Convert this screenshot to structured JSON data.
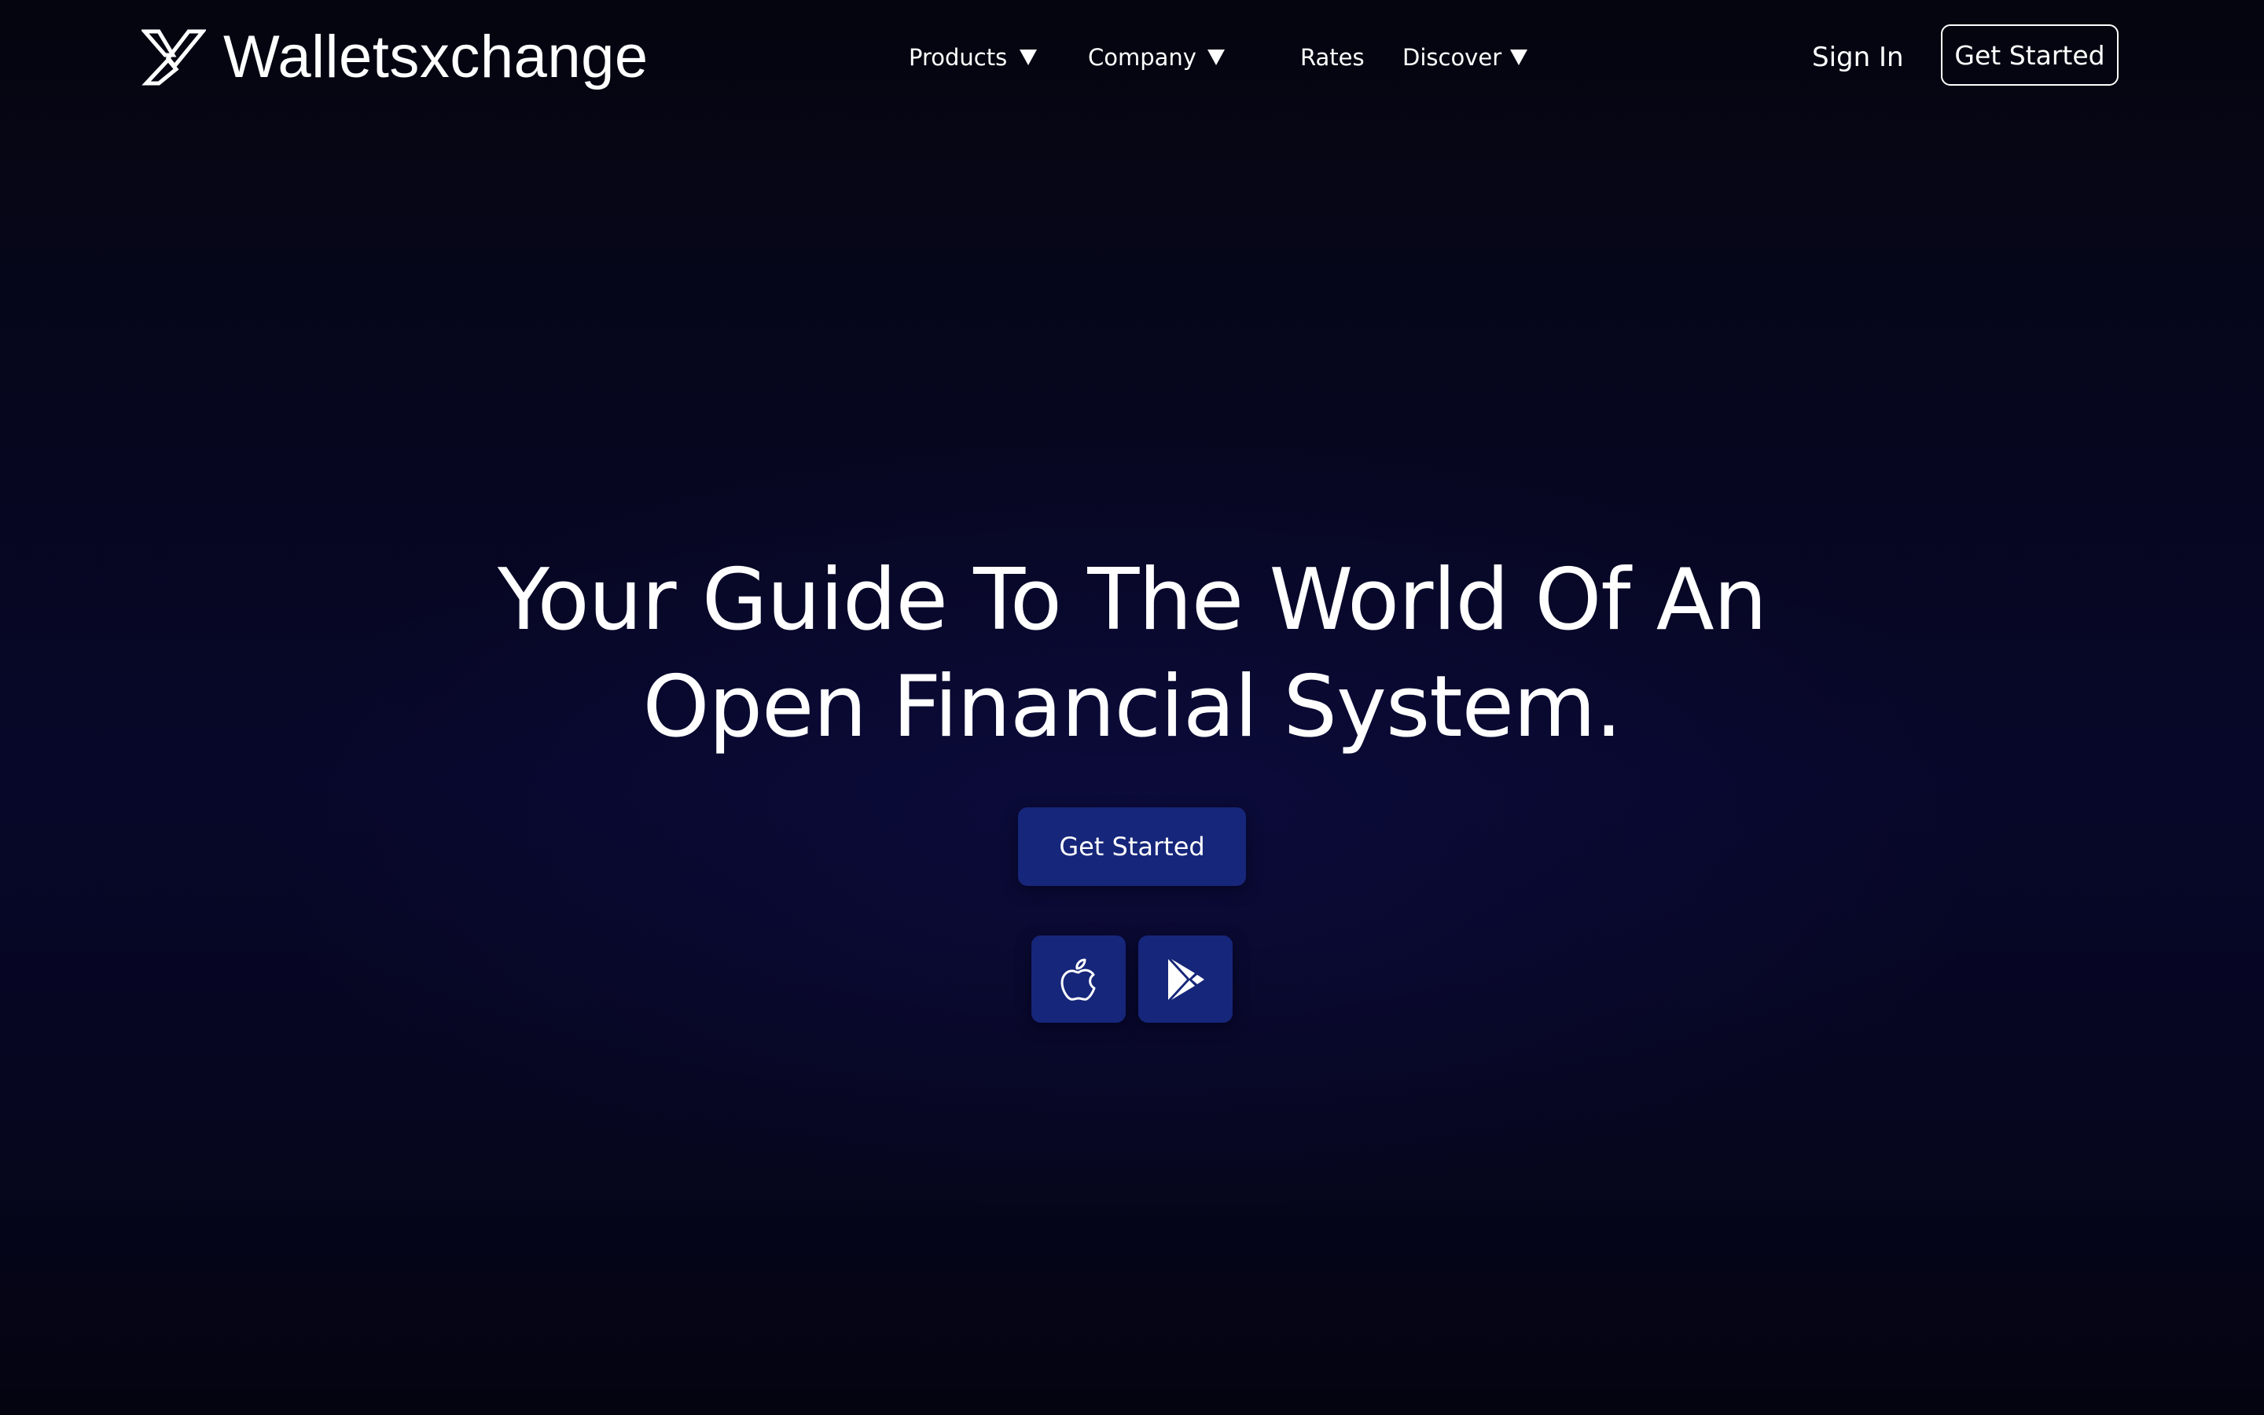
{
  "header": {
    "brand_name": "Walletsxchange",
    "brand_icon": "walletsxchange-logo-icon",
    "nav": {
      "products_label": "Products",
      "company_label": "Company",
      "rates_label": "Rates",
      "discover_label": "Discover",
      "dropdown_icon": "caret-down-icon"
    },
    "sign_in_label": "Sign In",
    "get_started_label": "Get Started"
  },
  "hero": {
    "title_line1": "Your Guide To The World Of An",
    "title_line2": "Open Financial System.",
    "cta_label": "Get Started",
    "store_buttons": [
      {
        "icon": "apple-icon"
      },
      {
        "icon": "google-play-icon"
      }
    ]
  },
  "colors": {
    "background_top": "#05050f",
    "background_mid": "#07072a",
    "button_fill": "#16267a",
    "text": "#ffffff"
  }
}
